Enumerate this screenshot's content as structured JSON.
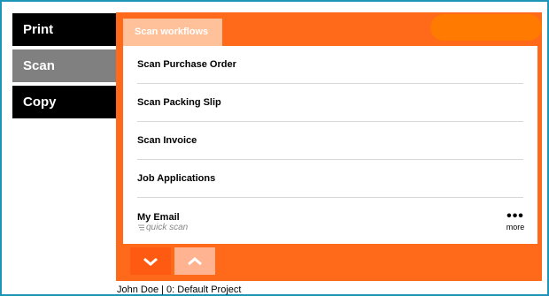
{
  "nav": {
    "items": [
      {
        "label": "Print"
      },
      {
        "label": "Scan"
      },
      {
        "label": "Copy"
      }
    ]
  },
  "panel": {
    "tab_label": "Scan workflows",
    "workflows": [
      {
        "label": "Scan Purchase Order"
      },
      {
        "label": "Scan Packing Slip"
      },
      {
        "label": "Scan Invoice"
      },
      {
        "label": "Job Applications"
      },
      {
        "label": "My Email",
        "sublabel": "quick scan"
      }
    ],
    "more_label": "more",
    "more_icon": "ellipsis-icon",
    "scroll_down_icon": "chevron-down-icon",
    "scroll_up_icon": "chevron-up-icon"
  },
  "footer": {
    "status": "John Doe | 0: Default Project"
  },
  "colors": {
    "frame": "#1c95b6",
    "accent": "#ff6a1a",
    "nav_active": "#808080",
    "nav_inactive": "#000000"
  }
}
